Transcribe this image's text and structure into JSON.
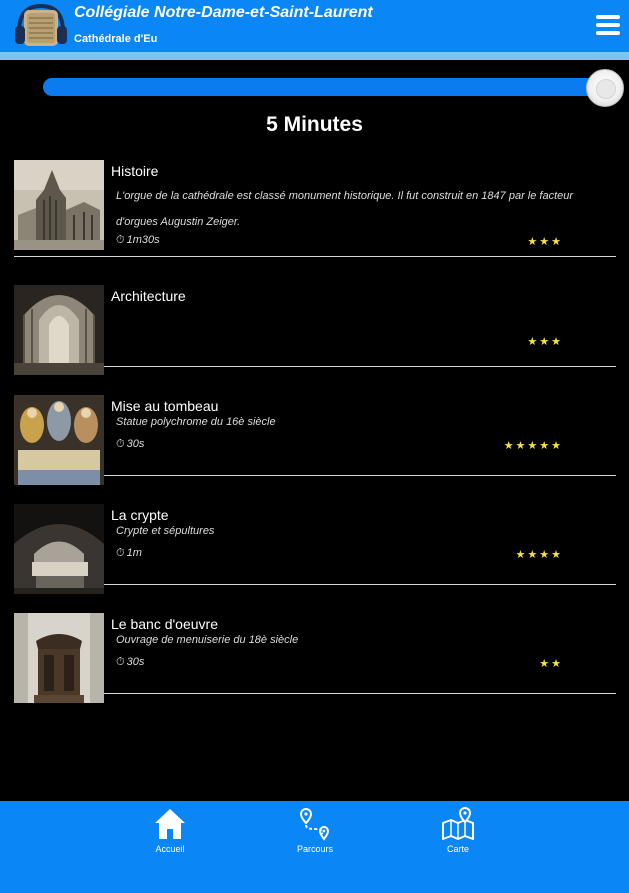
{
  "header": {
    "title": "Collégiale Notre-Dame-et-Saint-Laurent",
    "subtitle": "Cathédrale d'Eu"
  },
  "player": {
    "progress_fraction": 1.0
  },
  "duration_title": "5 Minutes",
  "items": [
    {
      "title": "Histoire",
      "description": "L'orgue de la cathédrale est classé monument historique. Il fut construit en 1847 par le facteur d'orgues Augustin Zeiger.",
      "time": "1m30s",
      "stars": "★★★"
    },
    {
      "title": "Architecture",
      "description": "",
      "time": "",
      "stars": "★★★"
    },
    {
      "title": "Mise au tombeau",
      "description": "Statue polychrome du 16è siècle",
      "time": "30s",
      "stars": "★★★★★"
    },
    {
      "title": "La crypte",
      "description": "Crypte et sépultures",
      "time": "1m",
      "stars": "★★★★"
    },
    {
      "title": "Le banc d'oeuvre",
      "description": "Ouvrage de menuiserie du 18è siècle",
      "time": "30s",
      "stars": "★★"
    }
  ],
  "nav": {
    "home": "Accueil",
    "route": "Parcours",
    "map": "Carte"
  },
  "colors": {
    "primary": "#0a86f5",
    "star": "#f5e04a",
    "background": "#000000"
  }
}
